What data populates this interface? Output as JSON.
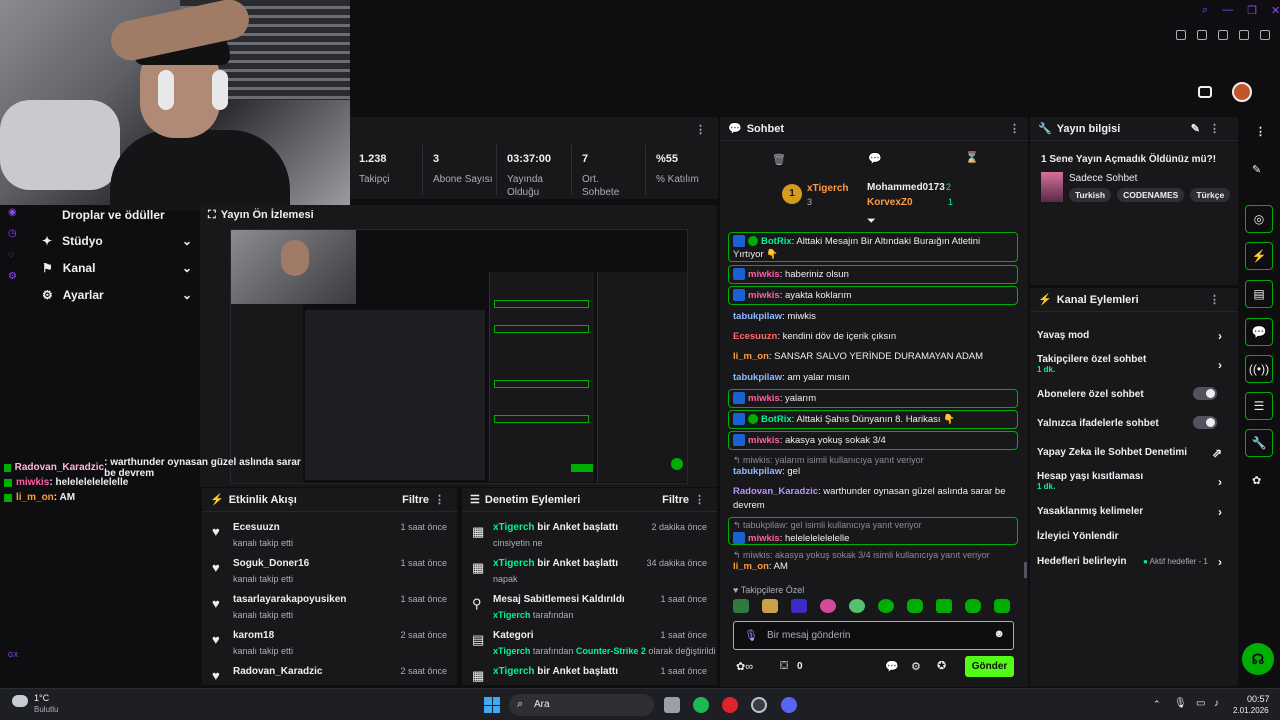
{
  "stats": [
    {
      "value": "1.238",
      "label": "Takipçi"
    },
    {
      "value": "3",
      "label": "Abone Sayısı"
    },
    {
      "value": "03:37:00",
      "label": "Yayında Olduğu"
    },
    {
      "value": "7",
      "label": "Ort. Sohbete"
    },
    {
      "value": "%55",
      "label": "% Katılım"
    }
  ],
  "nav": {
    "drops": "Droplar ve ödüller",
    "studio": "Stüdyo",
    "channel": "Kanal",
    "settings": "Ayarlar"
  },
  "preview": {
    "title": "Yayın Ön İzlemesi"
  },
  "overlay_chat": [
    {
      "user": "Radovan_Karadzic",
      "text": ": warthunder oynasan güzel aslında sarar be devrem"
    },
    {
      "user": "miwkis",
      "text": ": helelelelelelelle"
    },
    {
      "user": "li_m_on",
      "text": ": AM"
    }
  ],
  "activity": {
    "title": "Etkinlik Akışı",
    "filter": "Filtre",
    "items": [
      {
        "name": "Ecesuuzn",
        "sub": "kanalı takip etti",
        "time": "1 saat önce"
      },
      {
        "name": "Soguk_Doner16",
        "sub": "kanalı takip etti",
        "time": "1 saat önce"
      },
      {
        "name": "tasarlayarakapoyusiken",
        "sub": "kanalı takip etti",
        "time": "1 saat önce"
      },
      {
        "name": "karom18",
        "sub": "kanalı takip etti",
        "time": "2 saat önce"
      },
      {
        "name": "Radovan_Karadzic",
        "sub": "",
        "time": "2 saat önce"
      }
    ]
  },
  "moderation": {
    "title": "Denetim Eylemleri",
    "filter": "Filtre",
    "items": [
      {
        "actor": "xTigerch",
        "action": " bir Anket başlattı",
        "sub": "cinsiyetin ne",
        "time": "2 dakika önce"
      },
      {
        "actor": "xTigerch",
        "action": " bir Anket başlattı",
        "sub": "napak",
        "time": "34 dakika önce"
      },
      {
        "actor": "",
        "action": "Mesaj Sabitlemesi Kaldırıldı",
        "sub_user": "xTigerch",
        "sub": " tarafından",
        "time": "1 saat önce"
      },
      {
        "actor": "",
        "action": "Kategori",
        "sub_user": "xTigerch",
        "sub": " tarafından ",
        "sub_game": "Counter-Strike 2",
        "sub_tail": " olarak değiştirildi",
        "time": "1 saat önce"
      },
      {
        "actor": "xTigerch",
        "action": " bir Anket başlattı",
        "sub": "",
        "time": "1 saat önce"
      }
    ]
  },
  "chat": {
    "title": "Sohbet",
    "leaders": {
      "first_name": "xTigerch",
      "first_count": "3",
      "second_name": "Mohammed0173",
      "second_count": "2",
      "third_name": "KorvexZ0",
      "third_count": "1",
      "rank": "1"
    },
    "messages": [
      {
        "user": "BotRix",
        "text": ": Alttaki Mesajın Bir Altındaki Buraığın Atletini Yırtıyor 👇"
      },
      {
        "user": "miwkis",
        "text": ": haberiniz olsun"
      },
      {
        "user": "miwkis",
        "text": ": ayakta koklarım"
      },
      {
        "user": "tabukpilaw",
        "text": ": miwkis"
      },
      {
        "user": "Ecesuuzn",
        "text": ": kendini döv de içerik çıksın"
      },
      {
        "user": "li_m_on",
        "text": ": SANSAR SALVO YERİNDE DURAMAYAN ADAM"
      },
      {
        "user": "tabukpilaw",
        "text": ": am yalar mısın"
      },
      {
        "user": "miwkis",
        "text": ": yalarım"
      },
      {
        "user": "BotRix",
        "text": ": Alttaki Şahıs Dünyanın 8. Harikası 👇"
      },
      {
        "user": "miwkis",
        "text": ": akasya yokuş sokak 3/4"
      },
      {
        "reply": "miwkis: yalarım isimli kullanıcıya yanıt veriyor"
      },
      {
        "user": "tabukpilaw",
        "text": ": gel"
      },
      {
        "user": "Radovan_Karadzic",
        "text": ": warthunder oynasan güzel aslında sarar be devrem"
      },
      {
        "reply": "tabukpilaw: gel isimli kullanıcıya yanıt veriyor"
      },
      {
        "user": "miwkis",
        "text": ": helelelelelelelle"
      },
      {
        "reply": "miwkis: akasya yokuş sokak 3/4 isimli kullanıcıya yanıt veriyor"
      },
      {
        "user": "li_m_on",
        "text": ": AM"
      }
    ],
    "followers_only": "Takipçilere Özel",
    "placeholder": "Bir mesaj gönderin",
    "points": "0",
    "send": "Gönder"
  },
  "info": {
    "title": "Yayın bilgisi",
    "stream_title": "1 Sene Yayın Açmadık Öldünüz mü?!",
    "category": "Sadece Sohbet",
    "tags": [
      "Turkish",
      "CODENAMES",
      "Türkçe"
    ]
  },
  "actions": {
    "title": "Kanal Eylemleri",
    "items": [
      {
        "label": "Yavaş mod",
        "sub": ""
      },
      {
        "label": "Takipçilere özel sohbet",
        "sub": "1 dk."
      },
      {
        "label": "Abonelere özel sohbet",
        "sub": ""
      },
      {
        "label": "Yalnızca ifadelerle sohbet",
        "sub": ""
      },
      {
        "label": "Yapay Zeka ile Sohbet Denetimi",
        "sub": ""
      },
      {
        "label": "Hesap yaşı kısıtlaması",
        "sub": "1 dk."
      },
      {
        "label": "Yasaklanmış kelimeler",
        "sub": ""
      },
      {
        "label": "İzleyici Yönlendir",
        "sub": ""
      },
      {
        "label": "Hedefleri belirleyin",
        "sub": "",
        "extra": "Aktif hedefler - 1"
      }
    ]
  },
  "taskbar": {
    "temp": "1°C",
    "weather": "Bulutlu",
    "search": "Ara",
    "time": "00:57",
    "date": "2.01.2026",
    "gx": "GX"
  },
  "colors": {
    "accent": "#00ad03",
    "bright": "#00f593",
    "bg": "#0e0e10",
    "panel": "#18181b",
    "twitch": "#9147ff"
  }
}
